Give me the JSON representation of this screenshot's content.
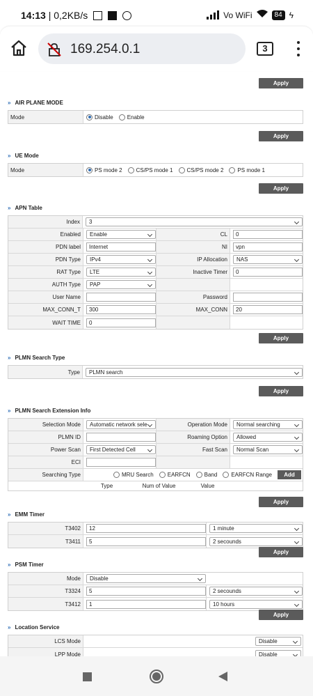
{
  "status": {
    "time": "14:13",
    "net": "| 0,2KB/s",
    "signal": "Vo WiFi",
    "battery": "84"
  },
  "browser": {
    "url": "169.254.0.1",
    "tab_count": "3"
  },
  "apply_label": "Apply",
  "airplane": {
    "title": "AIR PLANE MODE",
    "label": "Mode",
    "options": [
      "Disable",
      "Enable"
    ],
    "selected": "Disable"
  },
  "ue": {
    "title": "UE Mode",
    "label": "Mode",
    "options": [
      "PS mode 2",
      "CS/PS mode 1",
      "CS/PS mode 2",
      "PS mode 1"
    ],
    "selected": "PS mode 2"
  },
  "apn": {
    "title": "APN Table",
    "index_label": "Index",
    "index": "3",
    "enabled_label": "Enabled",
    "enabled": "Enable",
    "cl_label": "CL",
    "cl": "0",
    "pdn_label_label": "PDN label",
    "pdn_label": "Internet",
    "ni_label": "NI",
    "ni": "vpn",
    "pdn_type_label": "PDN Type",
    "pdn_type": "IPv4",
    "ip_alloc_label": "IP Allocation",
    "ip_alloc": "NAS",
    "rat_label": "RAT Type",
    "rat": "LTE",
    "inactive_label": "Inactive Timer",
    "inactive": "0",
    "auth_label": "AUTH Type",
    "auth": "PAP",
    "user_label": "User Name",
    "user": "",
    "pass_label": "Password",
    "pass": "",
    "max_conn_t_label": "MAX_CONN_T",
    "max_conn_t": "300",
    "max_conn_label": "MAX_CONN",
    "max_conn": "20",
    "wait_label": "WAIT TIME",
    "wait": "0"
  },
  "plmn_type": {
    "title": "PLMN Search Type",
    "label": "Type",
    "value": "PLMN search"
  },
  "plmn_ext": {
    "title": "PLMN Search Extension Info",
    "sel_mode_label": "Selection Mode",
    "sel_mode": "Automatic network sele",
    "op_mode_label": "Operation Mode",
    "op_mode": "Normal searching",
    "plmn_id_label": "PLMN ID",
    "plmn_id": "",
    "roaming_label": "Roaming Option",
    "roaming": "Allowed",
    "power_label": "Power Scan",
    "power": "First Detected Cell",
    "fast_label": "Fast Scan",
    "fast": "Normal Scan",
    "eci_label": "ECI",
    "eci": "",
    "stype_label": "Searching Type",
    "stype_options": [
      "MRU Search",
      "EARFCN",
      "Band",
      "EARFCN Range"
    ],
    "add_label": "Add",
    "cols": [
      "Type",
      "Num of Value",
      "Value"
    ]
  },
  "emm": {
    "title": "EMM Timer",
    "t3402_label": "T3402",
    "t3402": "12",
    "t3402_unit": "1 minute",
    "t3411_label": "T3411",
    "t3411": "5",
    "t3411_unit": "2 secounds"
  },
  "psm": {
    "title": "PSM Timer",
    "mode_label": "Mode",
    "mode": "Disable",
    "t3324_label": "T3324",
    "t3324": "5",
    "t3324_unit": "2 secounds",
    "t3412_label": "T3412",
    "t3412": "1",
    "t3412_unit": "10 hours"
  },
  "loc": {
    "title": "Location Service",
    "lcs_label": "LCS Mode",
    "lcs": "Disable",
    "lpp_label": "LPP Mode",
    "lpp": "Disable"
  }
}
